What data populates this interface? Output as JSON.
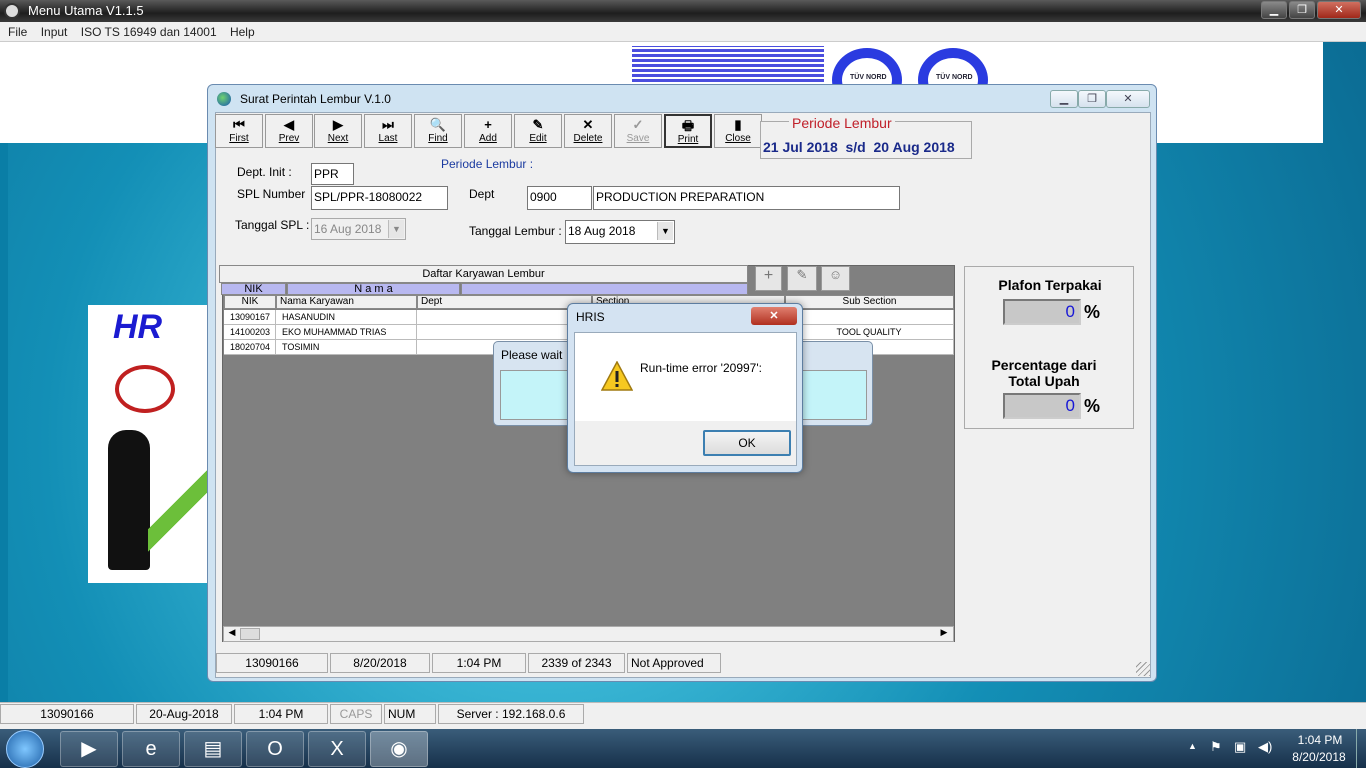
{
  "main_window": {
    "title": "Menu Utama V1.1.5",
    "minimize": "▁",
    "restore": "❐",
    "close": "✕"
  },
  "menu": [
    "File",
    "Input",
    "ISO TS 16949 dan 14001",
    "Help"
  ],
  "logos": [
    "TÜV NORD",
    "TÜV NORD"
  ],
  "hr_card": {
    "title": "HR"
  },
  "sub_window": {
    "title": "Surat Perintah Lembur V.1.0",
    "toolbar": [
      {
        "glyph": "⏮",
        "label": "First",
        "enabled": true
      },
      {
        "glyph": "◀",
        "label": "Prev",
        "enabled": true
      },
      {
        "glyph": "▶",
        "label": "Next",
        "enabled": true
      },
      {
        "glyph": "⏭",
        "label": "Last",
        "enabled": true
      },
      {
        "glyph": "🔍",
        "label": "Find",
        "enabled": true
      },
      {
        "glyph": "+",
        "label": "Add",
        "enabled": true
      },
      {
        "glyph": "✎",
        "label": "Edit",
        "enabled": true
      },
      {
        "glyph": "✕",
        "label": "Delete",
        "enabled": true
      },
      {
        "glyph": "✓",
        "label": "Save",
        "enabled": false
      },
      {
        "glyph": "🖶",
        "label": "Print",
        "enabled": true
      },
      {
        "glyph": "▮",
        "label": "Close",
        "enabled": true
      }
    ],
    "periode_box": {
      "title": "Periode Lembur",
      "value": "21 Jul 2018  s/d  20 Aug 2018"
    },
    "form": {
      "dept_init_label": "Dept. Init :",
      "dept_init_value": "PPR",
      "periode_label": "Periode Lembur  :",
      "spl_number_label": "SPL  Number",
      "spl_number_value": "SPL/PPR-18080022",
      "dept_label": "Dept",
      "dept_code": "0900",
      "dept_name": "PRODUCTION PREPARATION",
      "tanggal_spl_label": "Tanggal SPL :",
      "tanggal_spl_value": "16 Aug 2018",
      "tanggal_lembur_label": "Tanggal Lembur :",
      "tanggal_lembur_value": "18 Aug 2018"
    },
    "grid": {
      "caption": "Daftar Karyawan  Lembur",
      "sub_nik": "NIK",
      "sub_nama": "N a m a",
      "columns": [
        "NIK",
        "Nama Karyawan",
        "Dept",
        "Section",
        "Sub Section"
      ],
      "rows": [
        [
          "13090167",
          "HASANUDIN",
          "",
          "",
          ""
        ],
        [
          "14100203",
          "EKO MUHAMMAD TRIAS",
          "",
          "",
          "TOOL QUALITY"
        ],
        [
          "18020704",
          "TOSIMIN",
          "",
          "",
          ""
        ]
      ]
    },
    "status": [
      "13090166",
      "8/20/2018",
      "1:04 PM",
      "2339 of 2343",
      "Not Approved"
    ],
    "right_panel": {
      "plafon_label": "Plafon Terpakai",
      "plafon_value": "0",
      "percentage_label": "Percentage dari Total Upah",
      "percentage_value": "0",
      "pct_sign": "%"
    }
  },
  "please_wait": {
    "title": "Please wait"
  },
  "error_dialog": {
    "title": "HRIS",
    "message": "Run-time error '20997':",
    "ok": "OK"
  },
  "app_status": [
    "13090166",
    "20-Aug-2018",
    "1:04 PM",
    "CAPS",
    "NUM",
    "Server : 192.168.0.6"
  ],
  "taskbar": {
    "time": "1:04 PM",
    "date": "8/20/2018"
  }
}
